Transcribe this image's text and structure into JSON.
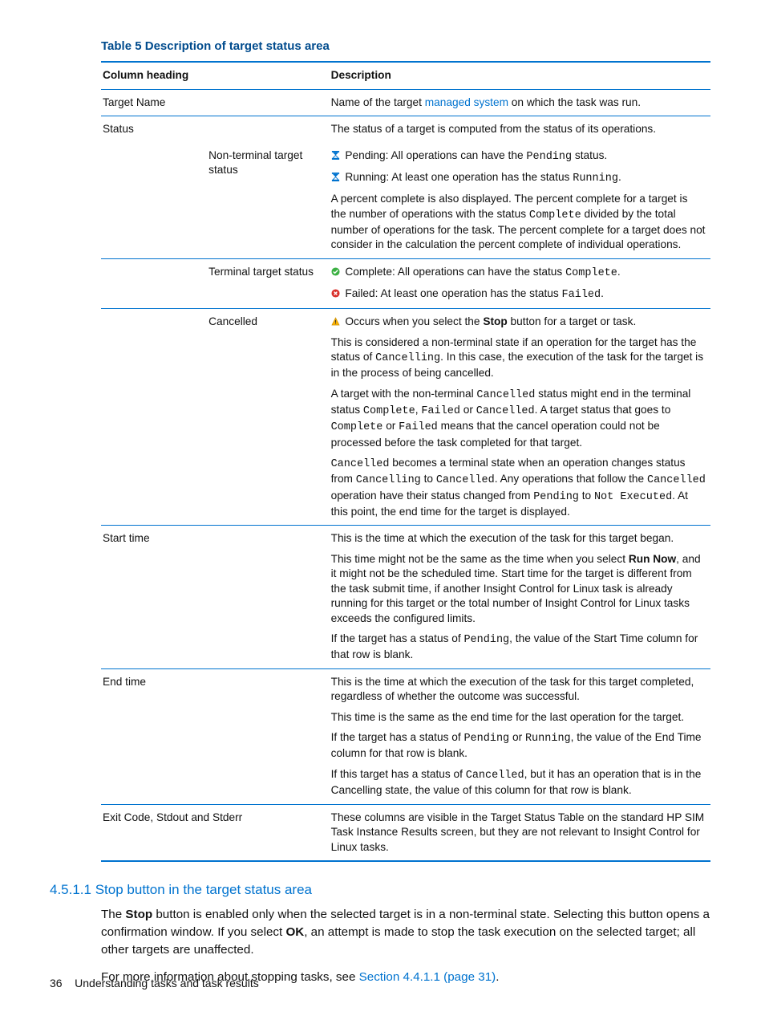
{
  "table": {
    "title": "Table 5 Description of target status area",
    "header": {
      "col1": "Column heading",
      "col3": "Description"
    },
    "targetName": {
      "label": "Target Name",
      "desc_pre": "Name of the target ",
      "link": "managed system",
      "desc_post": " on which the task was run."
    },
    "status": {
      "label": "Status",
      "desc": "The status of a target is computed from the status of its operations.",
      "nonTerminal": {
        "label": "Non-terminal target status",
        "pending_pre": " Pending: All operations can have the ",
        "pending_code": "Pending",
        "pending_post": " status.",
        "running_pre": " Running: At least one operation has the status ",
        "running_code": "Running",
        "running_post": ".",
        "percent_p1": "A percent complete is also displayed. The percent complete for a target is the number of operations with the status ",
        "percent_code": "Complete",
        "percent_p2": " divided by the total number of operations for the task. The percent complete for a target does not consider in the calculation the percent complete of individual operations."
      },
      "terminal": {
        "label": "Terminal target status",
        "complete_pre": " Complete: All operations can have the status ",
        "complete_code": "Complete",
        "complete_post": ".",
        "failed_pre": " Failed: At least one operation has the status ",
        "failed_code": "Failed",
        "failed_post": "."
      },
      "cancelled": {
        "label": "Cancelled",
        "p1_pre": " Occurs when you select the ",
        "p1_bold": "Stop",
        "p1_post": " button for a target or task.",
        "p2_pre": "This is considered a non-terminal state if an operation for the target has the status of ",
        "p2_code": "Cancelling",
        "p2_post": ". In this case, the execution of the task for the target is in the process of being cancelled.",
        "p3_a": "A target with the non-terminal ",
        "p3_code1": "Cancelled",
        "p3_b": " status might end in the terminal status ",
        "p3_code2": "Complete",
        "p3_c": ", ",
        "p3_code3": "Failed",
        "p3_d": " or ",
        "p3_code4": "Cancelled",
        "p3_e": ". A target status that goes to ",
        "p3_code5": "Complete",
        "p3_f": " or ",
        "p3_code6": "Failed",
        "p3_g": " means that the cancel operation could not be processed before the task completed for that target.",
        "p4_code1": "Cancelled",
        "p4_a": " becomes a terminal state when an operation changes status from ",
        "p4_code2": "Cancelling",
        "p4_b": " to ",
        "p4_code3": "Cancelled",
        "p4_c": ". Any operations that follow the ",
        "p4_code4": "Cancelled",
        "p4_d": " operation have their status changed from ",
        "p4_code5": "Pending",
        "p4_e": " to ",
        "p4_code6": "Not Executed",
        "p4_f": ". At this point, the end time for the target is displayed."
      }
    },
    "startTime": {
      "label": "Start time",
      "p1": "This is the time at which the execution of the task for this target began.",
      "p2_a": "This time might not be the same as the time when you select ",
      "p2_bold": "Run Now",
      "p2_b": ", and it might not be the scheduled time. Start time for the target is different from the task submit time, if another Insight Control for Linux task is already running for this target or the total number of Insight Control for Linux tasks exceeds the configured limits.",
      "p3_a": "If the target has a status of ",
      "p3_code": "Pending",
      "p3_b": ", the value of the Start Time column for that row is blank."
    },
    "endTime": {
      "label": "End time",
      "p1": "This is the time at which the execution of the task for this target completed, regardless of whether the outcome was successful.",
      "p2": "This time is the same as the end time for the last operation for the target.",
      "p3_a": "If the target has a status of ",
      "p3_code1": "Pending",
      "p3_b": " or ",
      "p3_code2": "Running",
      "p3_c": ", the value of the End Time column for that row is blank.",
      "p4_a": "If this target has a status of ",
      "p4_code": "Cancelled",
      "p4_b": ", but it has an operation that is in the Cancelling state, the value of this column for that row is blank."
    },
    "exitCode": {
      "label": "Exit Code, Stdout and Stderr",
      "desc": "These columns are visible in the Target Status Table on the standard HP SIM Task Instance Results screen, but they are not relevant to Insight Control for Linux tasks."
    }
  },
  "section": {
    "heading": "4.5.1.1 Stop button in the target status area",
    "p1_a": "The ",
    "p1_stop": "Stop",
    "p1_b": " button is enabled only when the selected target is in a non-terminal state. Selecting this button opens a confirmation window. If you select ",
    "p1_ok": "OK",
    "p1_c": ", an attempt is made to stop the task execution on the selected target; all other targets are unaffected.",
    "p2_a": "For more information about stopping tasks, see ",
    "p2_link": "Section 4.4.1.1 (page 31)",
    "p2_b": "."
  },
  "footer": {
    "page": "36",
    "chapter": "Understanding tasks and task results"
  }
}
